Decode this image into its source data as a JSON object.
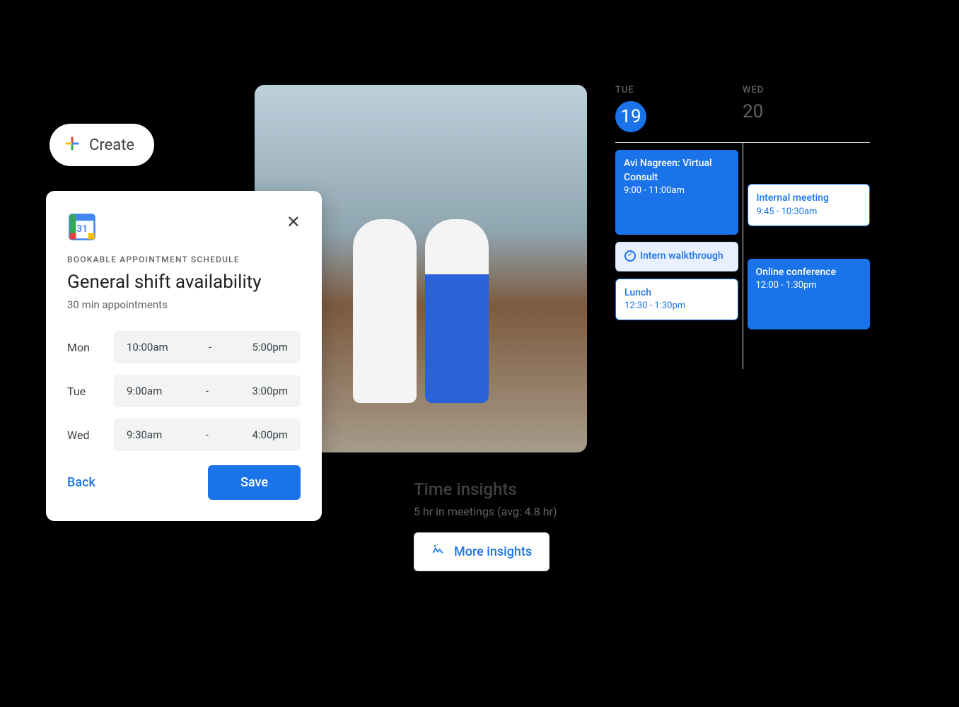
{
  "create": {
    "label": "Create"
  },
  "schedule": {
    "eyebrow": "BOOKABLE APPOINTMENT SCHEDULE",
    "title": "General shift availability",
    "subtitle": "30 min appointments",
    "rows": [
      {
        "day": "Mon",
        "start": "10:00am",
        "end": "5:00pm"
      },
      {
        "day": "Tue",
        "start": "9:00am",
        "end": "3:00pm"
      },
      {
        "day": "Wed",
        "start": "9:30am",
        "end": "4:00pm"
      }
    ],
    "back": "Back",
    "save": "Save"
  },
  "calendar": {
    "days": [
      {
        "label": "TUE",
        "num": "19",
        "active": true
      },
      {
        "label": "WED",
        "num": "20",
        "active": false
      }
    ],
    "col1": [
      {
        "type": "solid",
        "title": "Avi Nagreen: Virtual Consult",
        "time": "9:00 - 11:00am"
      },
      {
        "type": "light",
        "title": "Intern walkthrough",
        "time": ""
      },
      {
        "type": "outline",
        "title": "Lunch",
        "time": "12:30 - 1:30pm"
      }
    ],
    "col2": [
      {
        "type": "outline",
        "title": "Internal meeting",
        "time": "9:45 - 10:30am"
      },
      {
        "type": "solid",
        "title": "Online conference",
        "time": "12:00 - 1:30pm"
      }
    ]
  },
  "insights": {
    "heading": "Time insights",
    "summary": "5 hr in meetings (avg: 4.8 hr)",
    "more": "More insights"
  }
}
